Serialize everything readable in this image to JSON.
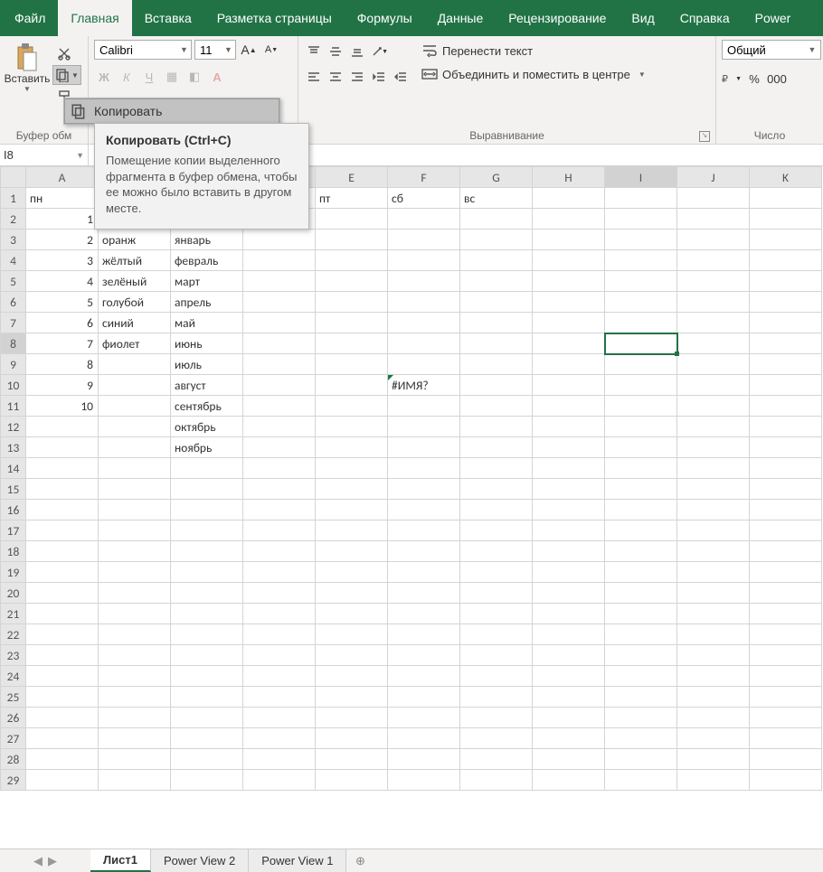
{
  "tabs": [
    "Файл",
    "Главная",
    "Вставка",
    "Разметка страницы",
    "Формулы",
    "Данные",
    "Рецензирование",
    "Вид",
    "Справка",
    "Power"
  ],
  "active_tab": 1,
  "clipboard": {
    "paste": "Вставить",
    "group_label": "Буфер обм"
  },
  "font": {
    "name": "Calibri",
    "size": "11"
  },
  "alignment": {
    "wrap": "Перенести текст",
    "merge": "Объединить и поместить в центре",
    "group_label": "Выравнивание"
  },
  "number": {
    "format": "Общий",
    "group_label": "Число"
  },
  "copy_menu": {
    "item": "Копировать"
  },
  "tooltip": {
    "title": "Копировать (Ctrl+C)",
    "body": "Помещение копии выделенного фрагмента в буфер обмена, чтобы ее можно было вставить в другом месте."
  },
  "name_box": "I8",
  "columns": [
    "A",
    "B",
    "C",
    "D",
    "E",
    "F",
    "G",
    "H",
    "I",
    "J",
    "K"
  ],
  "cells": {
    "A1": "пн",
    "E1": "пт",
    "F1": "сб",
    "G1": "вс",
    "A2": "1",
    "A3": "2",
    "A4": "3",
    "A5": "4",
    "A6": "5",
    "A7": "6",
    "A8": "7",
    "A9": "8",
    "A10": "9",
    "A11": "10",
    "B3": "оранж",
    "B4": "жёлтый",
    "B5": "зелёный",
    "B6": "голубой",
    "B7": "синий",
    "B8": "фиолет",
    "C3": "январь",
    "C4": "февраль",
    "C5": "март",
    "C6": "апрель",
    "C7": "май",
    "C8": "июнь",
    "C9": "июль",
    "C10": "август",
    "C11": "сентябрь",
    "C12": "октябрь",
    "C13": "ноябрь",
    "F10": "#ИМЯ?"
  },
  "selected_cell": "I8",
  "sheet_tabs": [
    "Лист1",
    "Power View 2",
    "Power View 1"
  ],
  "active_sheet": 0
}
